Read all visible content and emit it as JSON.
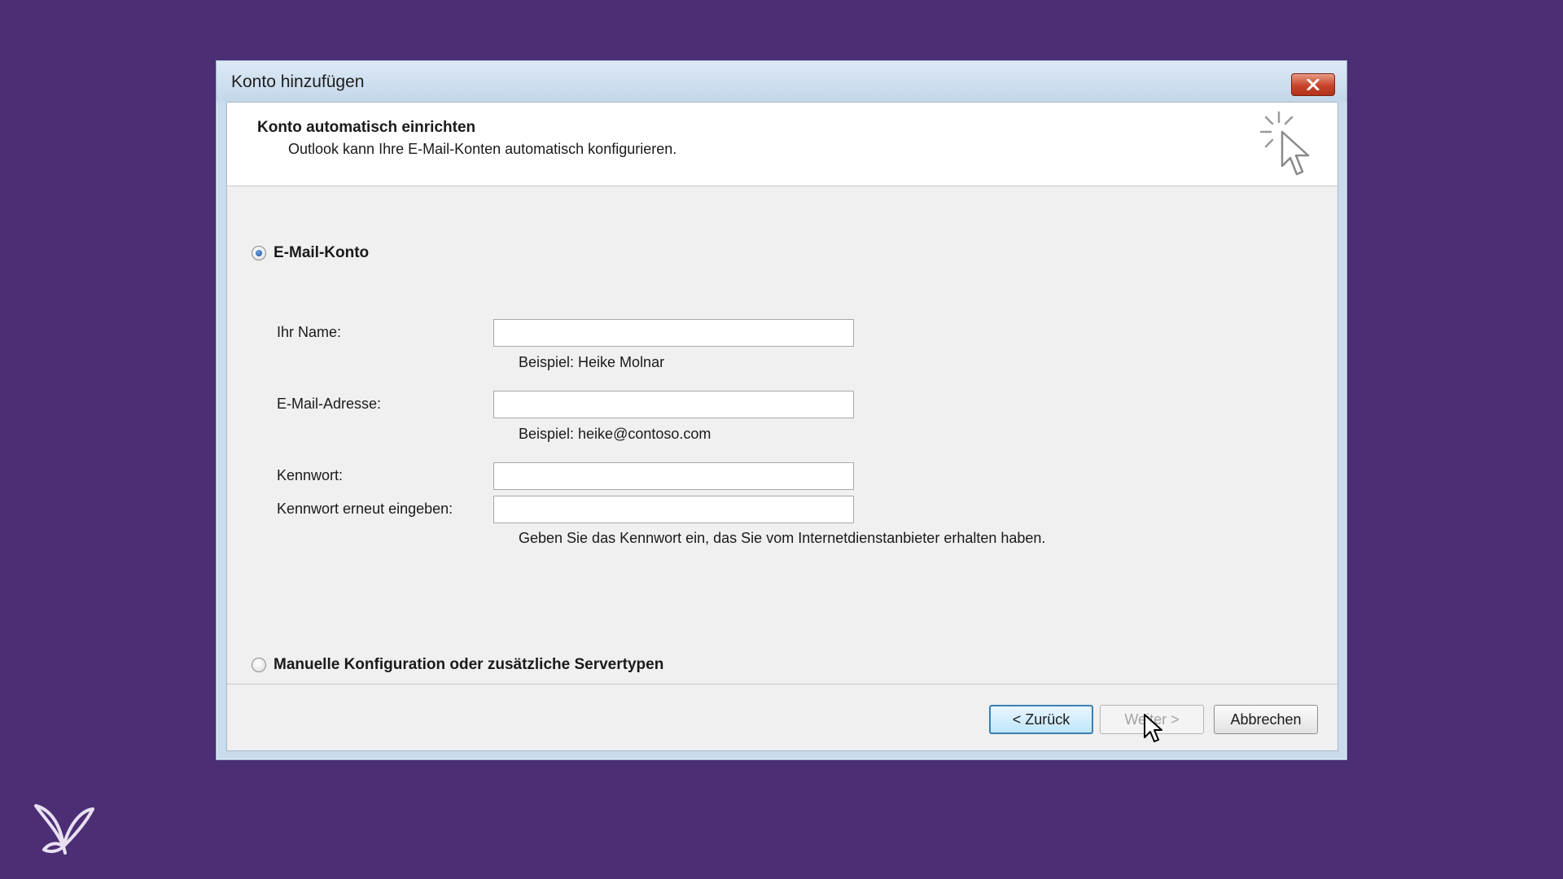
{
  "window": {
    "title": "Konto hinzufügen"
  },
  "header": {
    "title": "Konto automatisch einrichten",
    "subtitle": "Outlook kann Ihre E-Mail-Konten automatisch konfigurieren.",
    "icon": "sparkle-cursor-icon"
  },
  "email_option": {
    "label": "E-Mail-Konto",
    "selected": true
  },
  "form": {
    "name_label": "Ihr Name:",
    "name_value": "",
    "name_hint": "Beispiel: Heike Molnar",
    "email_label": "E-Mail-Adresse:",
    "email_value": "",
    "email_hint": "Beispiel: heike@contoso.com",
    "password_label": "Kennwort:",
    "password_value": "",
    "password_repeat_label": "Kennwort erneut eingeben:",
    "password_repeat_value": "",
    "password_hint": "Geben Sie das Kennwort ein, das Sie vom Internetdienstanbieter erhalten haben."
  },
  "manual_option": {
    "label": "Manuelle Konfiguration oder zusätzliche Servertypen",
    "selected": false
  },
  "buttons": {
    "back_label": "< Zurück",
    "next_label": "Weiter >",
    "cancel_label": "Abbrechen"
  },
  "colors": {
    "background": "#4b2e74",
    "close_button": "#c6442a",
    "focus_border": "#3c7fb1"
  }
}
